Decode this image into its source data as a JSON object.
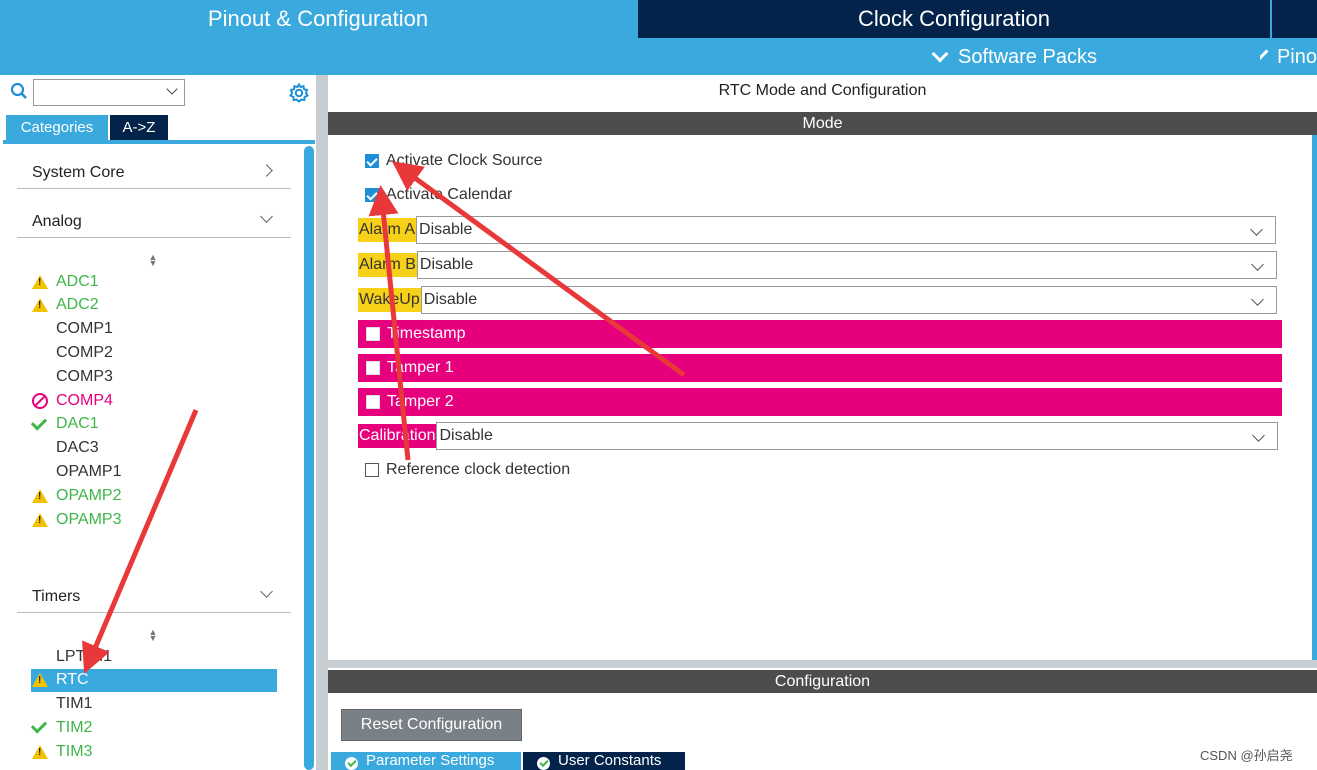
{
  "header": {
    "tab_pinout": "Pinout & Configuration",
    "tab_clock": "Clock Configuration",
    "software_packs": "Software Packs",
    "pinout_menu": "Pino"
  },
  "left": {
    "tab_categories": "Categories",
    "tab_az": "A->Z",
    "system_core": "System Core",
    "analog": "Analog",
    "analog_items": [
      {
        "label": "ADC1",
        "status": "warning"
      },
      {
        "label": "ADC2",
        "status": "warning"
      },
      {
        "label": "COMP1",
        "status": "none"
      },
      {
        "label": "COMP2",
        "status": "none"
      },
      {
        "label": "COMP3",
        "status": "none"
      },
      {
        "label": "COMP4",
        "status": "disabled"
      },
      {
        "label": "DAC1",
        "status": "ok"
      },
      {
        "label": "DAC3",
        "status": "none"
      },
      {
        "label": "OPAMP1",
        "status": "none"
      },
      {
        "label": "OPAMP2",
        "status": "warning"
      },
      {
        "label": "OPAMP3",
        "status": "warning"
      }
    ],
    "timers": "Timers",
    "timer_items": [
      {
        "label": "LPTIM1",
        "status": "none"
      },
      {
        "label": "RTC",
        "status": "warning",
        "selected": true
      },
      {
        "label": "TIM1",
        "status": "none"
      },
      {
        "label": "TIM2",
        "status": "ok"
      },
      {
        "label": "TIM3",
        "status": "warning"
      }
    ]
  },
  "right": {
    "title": "RTC Mode and Configuration",
    "mode_header": "Mode",
    "activate_clock_source": {
      "label": "Activate Clock Source",
      "checked": true
    },
    "activate_calendar": {
      "label": "Activate Calendar",
      "checked": true
    },
    "alarm_a": {
      "label": "Alarm A",
      "value": "Disable"
    },
    "alarm_b": {
      "label": "Alarm B",
      "value": "Disable"
    },
    "wakeup": {
      "label": "WakeUp",
      "value": "Disable"
    },
    "timestamp": {
      "label": "Timestamp",
      "checked": false
    },
    "tamper1": {
      "label": "Tamper 1",
      "checked": false
    },
    "tamper2": {
      "label": "Tamper 2",
      "checked": false
    },
    "calibration": {
      "label": "Calibration",
      "value": "Disable"
    },
    "reference_clock": {
      "label": "Reference clock detection",
      "checked": false
    },
    "config_header": "Configuration",
    "reset_button": "Reset Configuration",
    "tab_parameter_settings": "Parameter Settings",
    "tab_user_constants": "User Constants"
  },
  "watermark": "CSDN @孙启尧",
  "colors": {
    "accent_blue": "#3aa9dd",
    "dark_navy": "#03234b",
    "warning_yellow": "#f3c200",
    "ok_green": "#3fb64a",
    "magenta": "#e6007e",
    "annotation_red": "#e8383a"
  }
}
